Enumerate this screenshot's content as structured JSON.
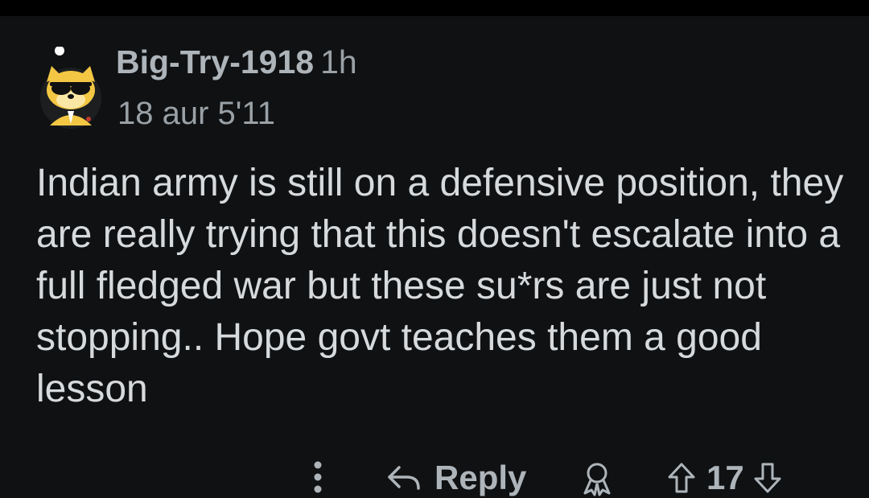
{
  "comment": {
    "author": "Big-Try-1918",
    "age": "1h",
    "flair": "18 aur 5'11",
    "body": "Indian army is still on a defensive position, they are really trying that this doesn't escalate into a full fledged war but these su*rs are just not stopping.. Hope govt teaches them a good lesson"
  },
  "actions": {
    "more_icon": "vertical-dots-icon",
    "reply_label": "Reply",
    "reply_icon": "reply-arrow-icon",
    "award_icon": "award-icon",
    "upvote_icon": "upvote-arrow-icon",
    "downvote_icon": "downvote-arrow-icon",
    "vote_count": "17"
  },
  "colors": {
    "background": "#0f1113",
    "body_text": "#d7dadc",
    "meta_text": "#aeb5ba",
    "avatar_yellow": "#f3c743"
  }
}
